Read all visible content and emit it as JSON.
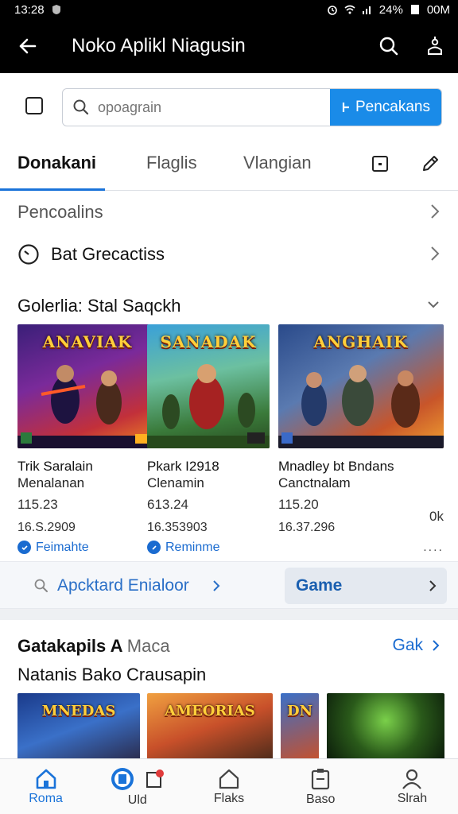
{
  "status_bar": {
    "time": "13:28",
    "battery": "24%",
    "extra": "00M"
  },
  "app_bar": {
    "title": "Noko Aplikl Niagusin"
  },
  "search": {
    "placeholder": "opoagrain",
    "button_label": "Pencakans"
  },
  "tabs": [
    {
      "label": "Donakani"
    },
    {
      "label": "Flaglis"
    },
    {
      "label": "Vlangian"
    }
  ],
  "rows": [
    {
      "label": "Pencoalins"
    },
    {
      "label": "Bat Grecactiss"
    }
  ],
  "section1": {
    "title": "Golerlia: Stal Saqckh"
  },
  "games": [
    {
      "logo": "ANAVIAK",
      "name": "Trik Saralain",
      "sub": "Menalanan",
      "price": "115.23",
      "date": "16.S.2909",
      "link": "Feimahte"
    },
    {
      "logo": "SANADAK",
      "name": "Pkark I2918",
      "sub": "Clenamin",
      "price": "613.24",
      "date": "16.353903",
      "link": "Reminme"
    },
    {
      "logo": "ANGHAIK",
      "name": "Mnadley bt Bndans",
      "sub": "Canctnalam",
      "price": "115.20",
      "price_right": "0k",
      "date": "16.37.296",
      "link": "...."
    }
  ],
  "strip": {
    "left_label": "Apcktard Enialoor",
    "game_label": "Game"
  },
  "section2": {
    "title_bold": "Gatakapils A",
    "title_light": "Maca",
    "more_label": "Gak",
    "subtitle": "Natanis Bako Crausapin"
  },
  "thumbs": [
    {
      "logo": "MNEDAS"
    },
    {
      "logo": "AMEORIAS"
    },
    {
      "logo": "DN"
    },
    {
      "logo": ""
    }
  ],
  "bottom_nav": [
    {
      "label": "Roma"
    },
    {
      "label": "Uld"
    },
    {
      "label": "Flaks"
    },
    {
      "label": "Baso"
    },
    {
      "label": "Slrah"
    }
  ],
  "colors": {
    "accent": "#1a8be8",
    "link": "#1a6bd0",
    "app_bar": "#000000"
  },
  "icons": {
    "back": "arrow-left-icon",
    "search": "search-icon",
    "share": "user-share-icon",
    "tab_box": "box-icon",
    "tab_edit": "pencil-icon",
    "clock": "clock-icon"
  }
}
